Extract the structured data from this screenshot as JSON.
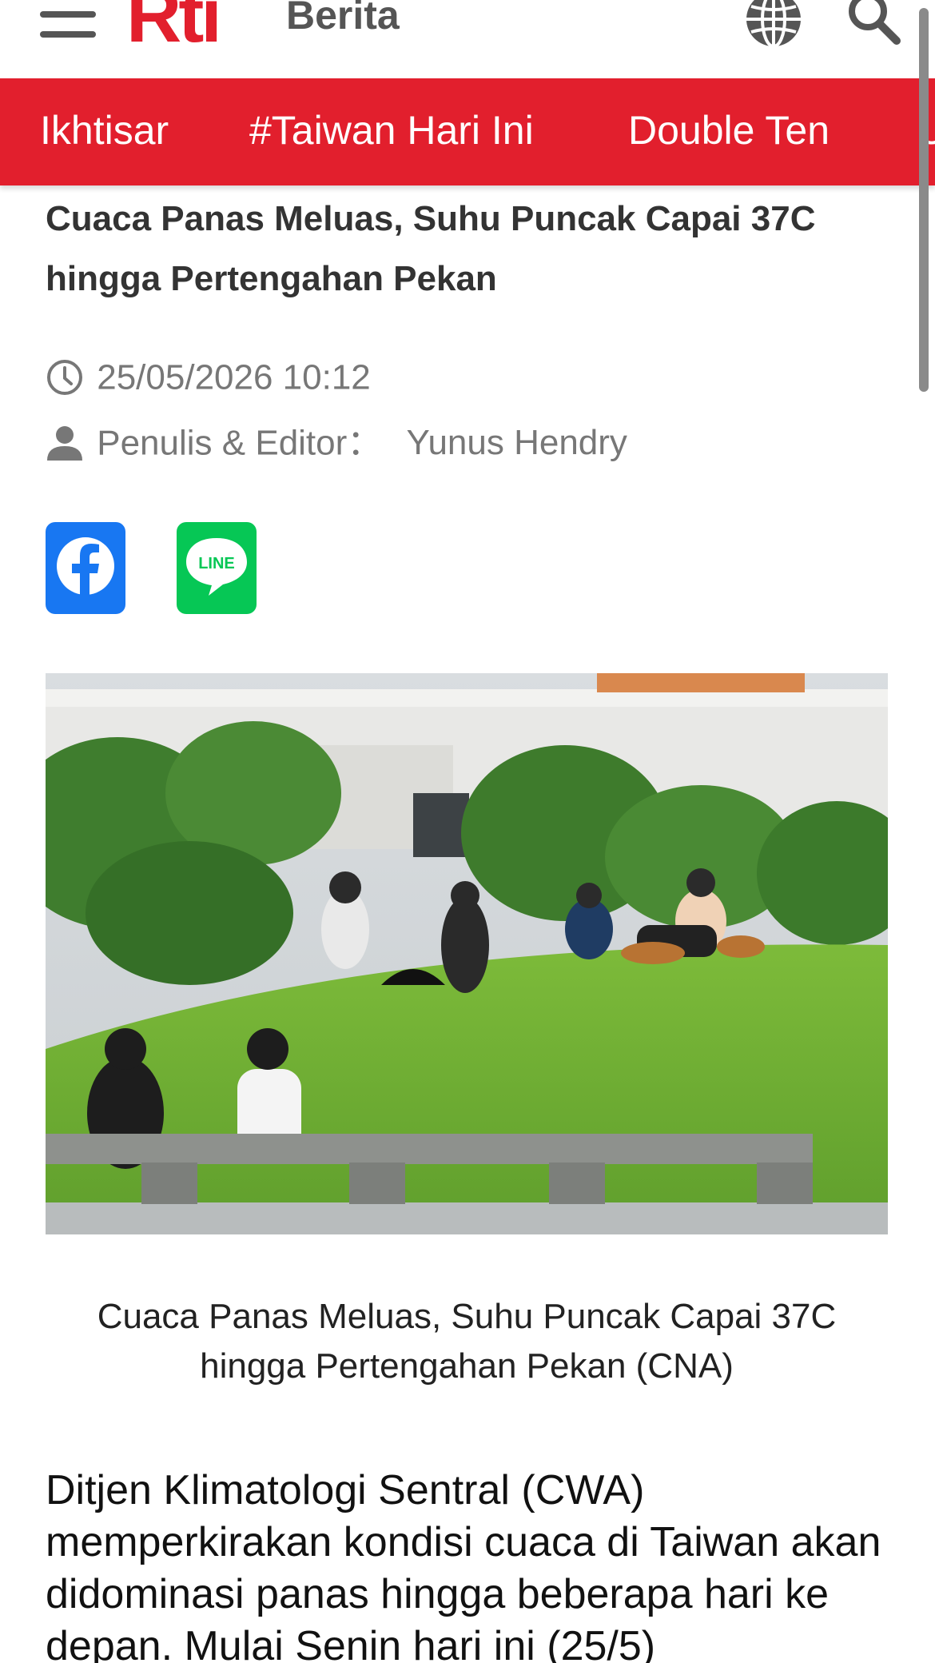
{
  "header": {
    "logo": "Rti",
    "section_title": "Berita"
  },
  "tabs": [
    {
      "label": "Ikhtisar"
    },
    {
      "label": "#Taiwan Hari Ini"
    },
    {
      "label": "Double Ten"
    },
    {
      "label": "U"
    }
  ],
  "article": {
    "headline": "Cuaca Panas Meluas, Suhu Puncak Capai 37C hingga Pertengahan Pekan",
    "datetime": "25/05/2026 10:12",
    "author_label": "Penulis & Editor：",
    "author_name": "Yunus Hendry",
    "share": {
      "facebook": "facebook",
      "line": "LINE"
    },
    "photo_caption": "Cuaca Panas Meluas, Suhu Puncak Capai 37C hingga Pertengahan Pekan (CNA)",
    "body": "Ditjen Klimatologi Sentral (CWA) memperkirakan kondisi cuaca di Taiwan akan didominasi panas hingga beberapa hari ke depan. Mulai Senin hari ini (25/5)"
  },
  "colors": {
    "brand_red": "#e21f2d",
    "facebook_blue": "#1877f2",
    "line_green": "#06c755",
    "meta_gray": "#777777"
  },
  "icons": [
    "menu-icon",
    "globe-icon",
    "search-icon",
    "clock-icon",
    "person-icon",
    "facebook-icon",
    "line-icon"
  ]
}
